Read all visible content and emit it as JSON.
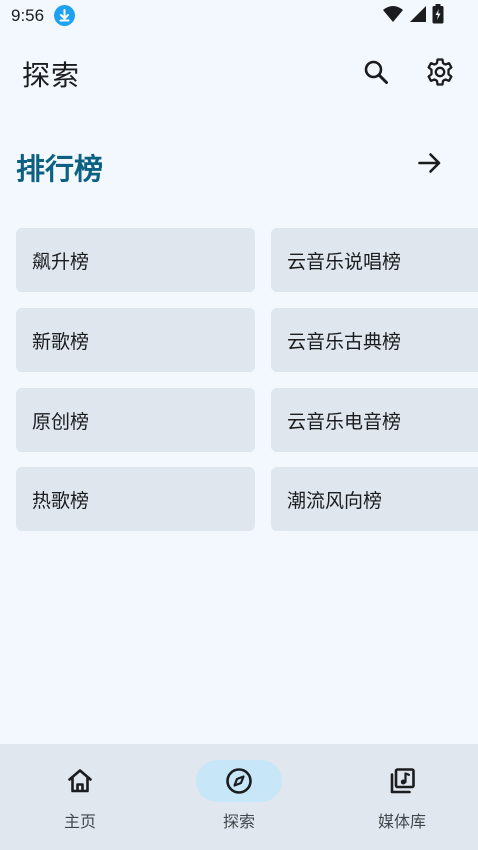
{
  "status_bar": {
    "time": "9:56"
  },
  "app_bar": {
    "title": "探索",
    "search_icon": "search-icon",
    "settings_icon": "gear-icon"
  },
  "rankings": {
    "title": "排行榜",
    "more_icon": "arrow-right-icon",
    "charts": [
      "飙升榜",
      "云音乐说唱榜",
      "新歌榜",
      "云音乐古典榜",
      "原创榜",
      "云音乐电音榜",
      "热歌榜",
      "潮流风向榜"
    ]
  },
  "bottom_nav": {
    "active": "探索",
    "items": [
      {
        "label": "主页",
        "icon": "home-icon"
      },
      {
        "label": "探索",
        "icon": "compass-icon"
      },
      {
        "label": "媒体库",
        "icon": "music-library-icon"
      }
    ]
  },
  "colors": {
    "background": "#f2f8fd",
    "accent": "#0c6182",
    "card": "#dfe6ee",
    "nav_background": "#e0e7ee",
    "nav_active_pill": "#c7e6f7",
    "download_badge": "#1ea1f1"
  }
}
